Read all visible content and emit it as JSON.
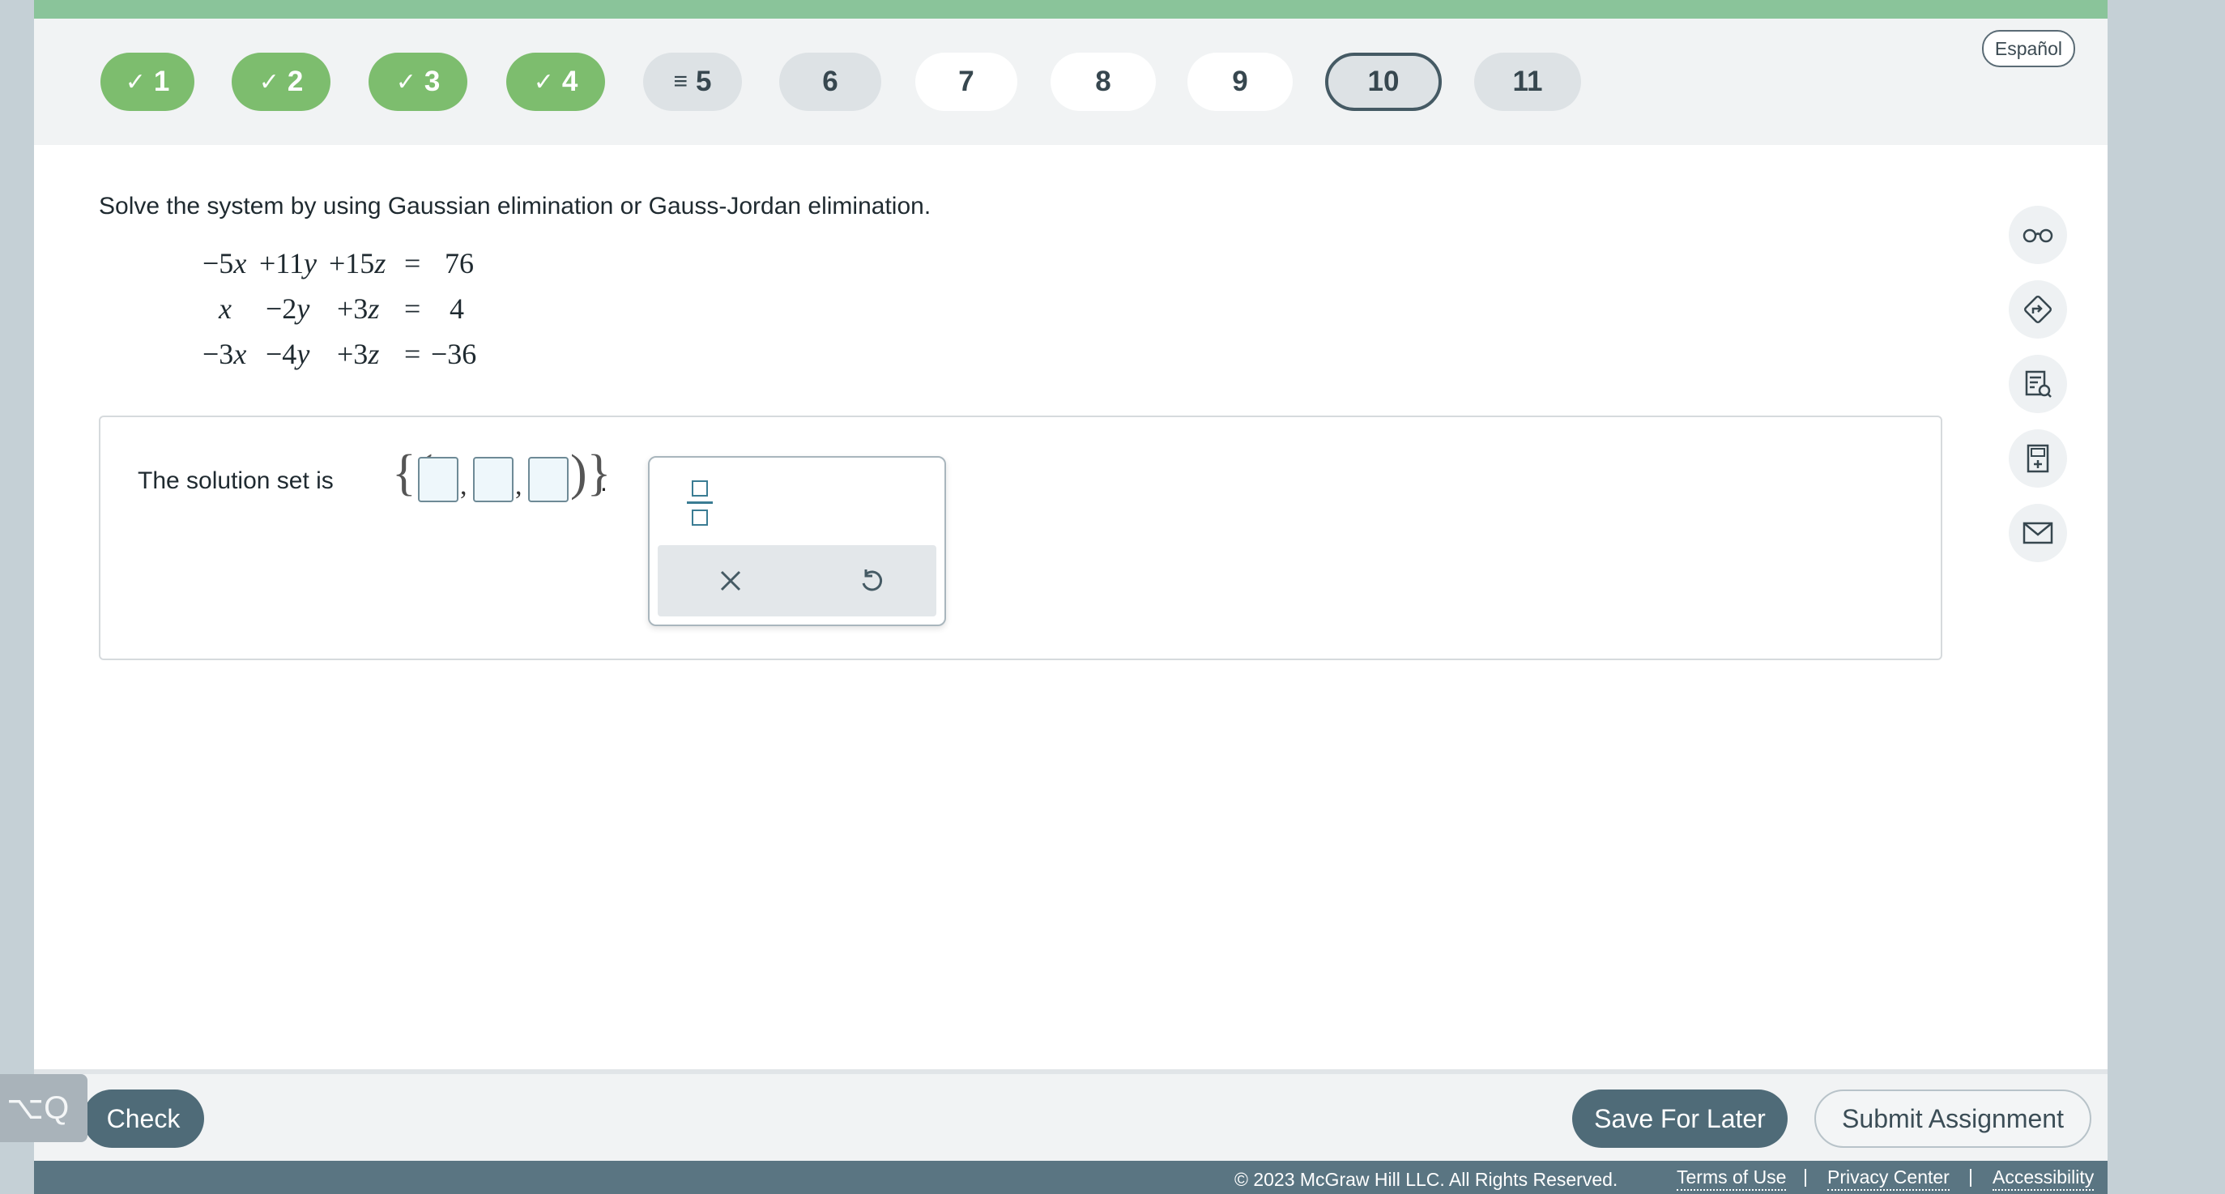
{
  "header": {
    "questions": [
      {
        "label": "1",
        "state": "done",
        "icon": "checkmark-icon"
      },
      {
        "label": "2",
        "state": "done",
        "icon": "checkmark-icon"
      },
      {
        "label": "3",
        "state": "done",
        "icon": "checkmark-icon"
      },
      {
        "label": "4",
        "state": "done",
        "icon": "checkmark-icon"
      },
      {
        "label": "5",
        "state": "partial",
        "icon": "partial-lines-icon"
      },
      {
        "label": "6",
        "state": "partial"
      },
      {
        "label": "7",
        "state": "pending"
      },
      {
        "label": "8",
        "state": "pending"
      },
      {
        "label": "9",
        "state": "pending"
      },
      {
        "label": "10",
        "state": "current"
      },
      {
        "label": "11",
        "state": "partial"
      }
    ],
    "language_label": "Español"
  },
  "question": {
    "prompt": "Solve the system by using Gaussian elimination or Gauss-Jordan elimination.",
    "equations": [
      {
        "terms": [
          "−5x",
          "+11y",
          "+15z"
        ],
        "rhs": "76"
      },
      {
        "terms": [
          "x",
          "−2y",
          "+3z"
        ],
        "rhs": "4"
      },
      {
        "terms": [
          "−3x",
          "−4y",
          "+3z"
        ],
        "rhs": "−36"
      }
    ],
    "equals": "="
  },
  "answer": {
    "label": "The solution set is",
    "open_brace": "{(",
    "close_brace": ")}",
    "comma": ",",
    "period": ".",
    "inputs": [
      "",
      "",
      ""
    ]
  },
  "palette": {
    "fraction_icon": "fraction-template-icon",
    "clear_icon": "x-clear-icon",
    "undo_icon": "undo-icon"
  },
  "tools": [
    "glasses-icon",
    "directions-icon",
    "notes-search-icon",
    "calculator-icon",
    "envelope-icon"
  ],
  "footer": {
    "overlay_text": "⌥Q",
    "check_label": "Check",
    "save_label": "Save For Later",
    "submit_label": "Submit Assignment",
    "copyright": "© 2023 McGraw Hill LLC. All Rights Reserved.",
    "links": [
      "Terms of Use",
      "Privacy Center",
      "Accessibility"
    ],
    "separator": "|"
  },
  "colors": {
    "done": "#7dbd6e",
    "accent": "#4f6b78",
    "top_strip": "#8ac49a",
    "copyright_bar": "#5a7582"
  }
}
